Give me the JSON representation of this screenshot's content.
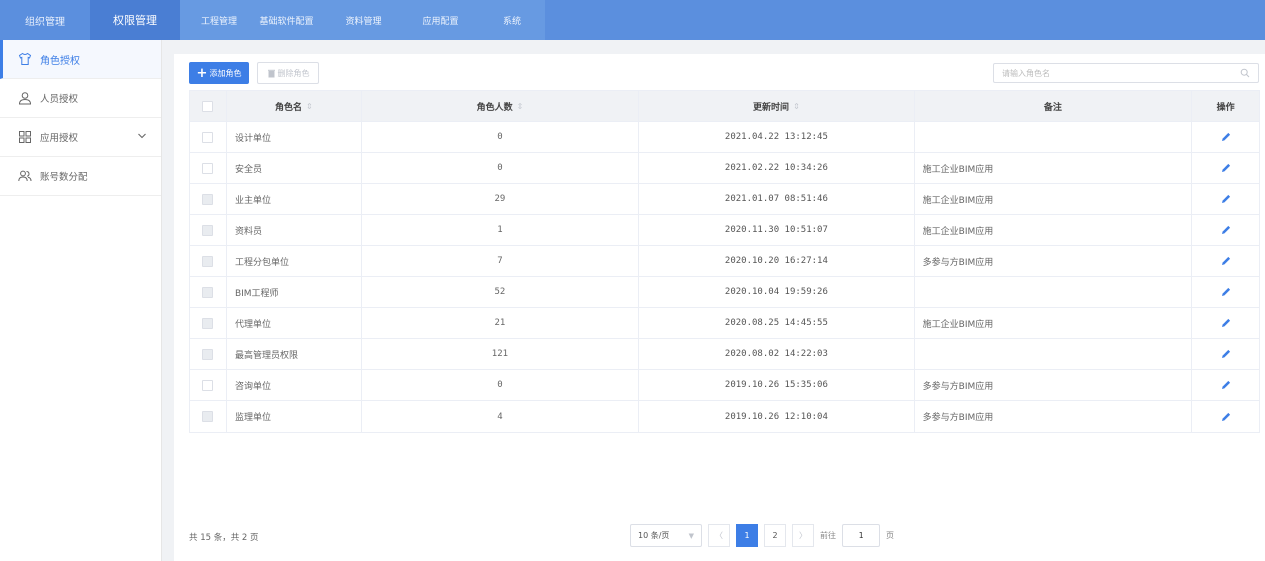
{
  "topnav": {
    "left_items": [
      {
        "label": "组织管理",
        "active": false
      },
      {
        "label": "权限管理",
        "active": true
      }
    ],
    "right_items": [
      {
        "label": "工程管理"
      },
      {
        "label": "基础软件配置"
      },
      {
        "label": "资料管理"
      },
      {
        "label": "应用配置"
      },
      {
        "label": "系统"
      }
    ]
  },
  "sidebar": {
    "items": [
      {
        "label": "角色授权",
        "icon": "shirt-icon",
        "active": true
      },
      {
        "label": "人员授权",
        "icon": "user-icon",
        "active": false
      },
      {
        "label": "应用授权",
        "icon": "grid-icon",
        "active": false,
        "expandable": true
      },
      {
        "label": "账号数分配",
        "icon": "users-icon",
        "active": false
      }
    ]
  },
  "toolbar": {
    "add_label": "添加角色",
    "delete_label": "删除角色"
  },
  "search": {
    "placeholder": "请输入角色名"
  },
  "table": {
    "columns": {
      "name": "角色名",
      "count": "角色人数",
      "time": "更新时间",
      "note": "备注",
      "op": "操作"
    },
    "rows": [
      {
        "name": "设计单位",
        "count": "0",
        "time": "2021.04.22 13:12:45",
        "note": ""
      },
      {
        "name": "安全员",
        "count": "0",
        "time": "2021.02.22 10:34:26",
        "note": "施工企业BIM应用"
      },
      {
        "name": "业主单位",
        "count": "29",
        "time": "2021.01.07 08:51:46",
        "note": "施工企业BIM应用"
      },
      {
        "name": "资料员",
        "count": "1",
        "time": "2020.11.30 10:51:07",
        "note": "施工企业BIM应用"
      },
      {
        "name": "工程分包单位",
        "count": "7",
        "time": "2020.10.20 16:27:14",
        "note": "多参与方BIM应用"
      },
      {
        "name": "BIM工程师",
        "count": "52",
        "time": "2020.10.04 19:59:26",
        "note": ""
      },
      {
        "name": "代理单位",
        "count": "21",
        "time": "2020.08.25 14:45:55",
        "note": "施工企业BIM应用"
      },
      {
        "name": "最高管理员权限",
        "count": "121",
        "time": "2020.08.02 14:22:03",
        "note": ""
      },
      {
        "name": "咨询单位",
        "count": "0",
        "time": "2019.10.26 15:35:06",
        "note": "多参与方BIM应用"
      },
      {
        "name": "监理单位",
        "count": "4",
        "time": "2019.10.26 12:10:04",
        "note": "多参与方BIM应用"
      }
    ]
  },
  "pagination": {
    "total_text": "共 15 条，共 2 页",
    "page_size": "10 条/页",
    "pages": [
      "1",
      "2"
    ],
    "current_page": "1",
    "goto_prefix": "前往",
    "goto_value": "1",
    "goto_suffix": "页"
  },
  "colors": {
    "nav": "#5b8fde",
    "primary": "#3d7ee6"
  }
}
